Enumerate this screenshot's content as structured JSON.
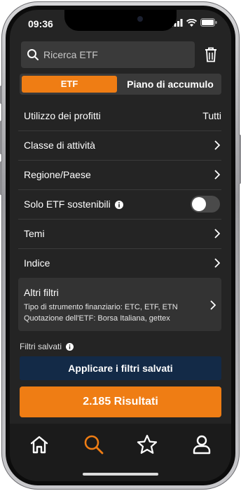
{
  "status_bar": {
    "time": "09:36"
  },
  "search": {
    "placeholder": "Ricerca ETF"
  },
  "segments": {
    "active": "ETF",
    "inactive": "Piano di accumulo"
  },
  "filters": {
    "use_of_profits": {
      "label": "Utilizzo dei profitti",
      "value": "Tutti"
    },
    "asset_class": {
      "label": "Classe di attività"
    },
    "region": {
      "label": "Regione/Paese"
    },
    "sustainable": {
      "label": "Solo ETF sostenibili",
      "enabled": false
    },
    "themes": {
      "label": "Temi"
    },
    "index": {
      "label": "Indice"
    }
  },
  "other_filters": {
    "title": "Altri filtri",
    "line1": "Tipo di strumento finanziario: ETC, ETF, ETN",
    "line2": "Quotazione dell'ETF: Borsa Italiana, gettex"
  },
  "saved_filters": {
    "label": "Filtri salvati",
    "button": "Applicare i filtri salvati"
  },
  "results_button": "2.185 Risultati",
  "tabs": [
    "home-icon",
    "search-icon",
    "star-icon",
    "user-icon"
  ],
  "colors": {
    "accent": "#ef7d14",
    "saved_button": "#132a47",
    "background": "#242424"
  }
}
